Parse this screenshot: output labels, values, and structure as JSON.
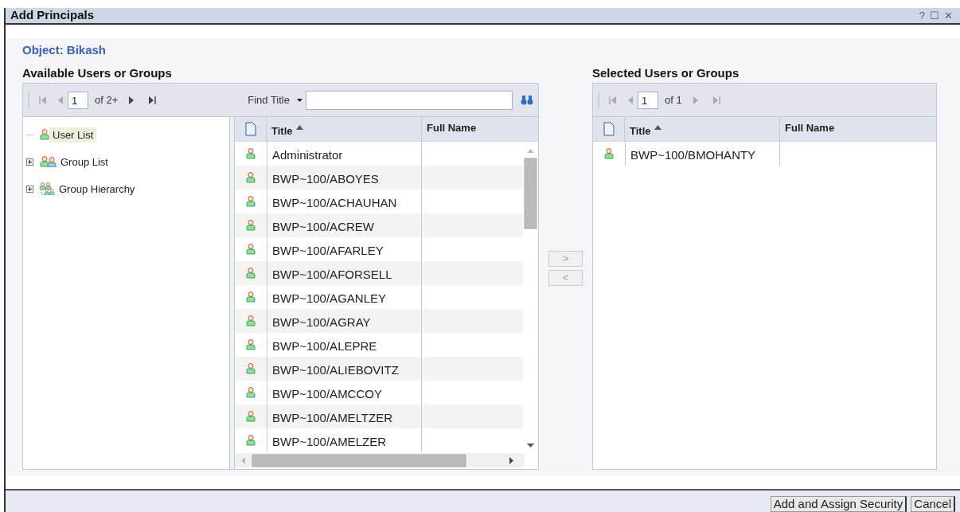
{
  "window": {
    "title": "Add Principals",
    "controls": [
      "?",
      "☐",
      "✕"
    ]
  },
  "object_label": "Object: Bikash",
  "available": {
    "heading": "Available Users or Groups",
    "pager": {
      "page": "1",
      "total": "of 2+",
      "can_go_back": false,
      "can_go_forward": true
    },
    "find": {
      "label": "Find Title"
    },
    "tree": [
      {
        "label": "User List",
        "kind": "user",
        "selected": true,
        "expandable": false
      },
      {
        "label": "Group List",
        "kind": "group",
        "selected": false,
        "expandable": true,
        "expanded": false
      },
      {
        "label": "Group Hierarchy",
        "kind": "hierarchy",
        "selected": false,
        "expandable": true,
        "expanded": false
      }
    ],
    "table": {
      "columns": [
        "Title",
        "Full Name"
      ],
      "rows": [
        "Administrator",
        "BWP~100/ABOYES",
        "BWP~100/ACHAUHAN",
        "BWP~100/ACREW",
        "BWP~100/AFARLEY",
        "BWP~100/AFORSELL",
        "BWP~100/AGANLEY",
        "BWP~100/AGRAY",
        "BWP~100/ALEPRE",
        "BWP~100/ALIEBOVITZ",
        "BWP~100/AMCCOY",
        "BWP~100/AMELTZER",
        "BWP~100/AMELZER"
      ]
    }
  },
  "transfer": [
    {
      "label": ">",
      "disabled": true
    },
    {
      "label": "<",
      "disabled": true
    }
  ],
  "selected": {
    "heading": "Selected Users or Groups",
    "pager": {
      "page": "1",
      "total": "of 1",
      "can_go_back": false,
      "can_go_forward": false
    },
    "table": {
      "columns": [
        "Title",
        "Full Name"
      ],
      "rows": [
        "BWP~100/BMOHANTY"
      ]
    }
  },
  "buttons": [
    "Add and Assign Security",
    "Cancel"
  ]
}
